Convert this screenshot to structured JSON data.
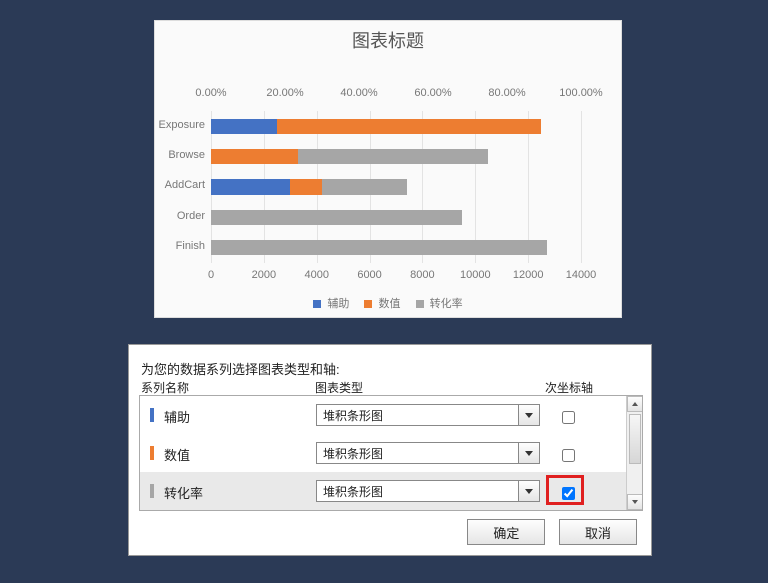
{
  "chart_data": {
    "type": "bar",
    "orientation": "horizontal",
    "stacked": true,
    "title": "图表标题",
    "categories": [
      "Exposure",
      "Browse",
      "AddCart",
      "Order",
      "Finish"
    ],
    "series": [
      {
        "name": "辅助",
        "color": "#4472c4",
        "values": [
          2500,
          0,
          3000,
          0,
          0
        ]
      },
      {
        "name": "数值",
        "color": "#ed7d31",
        "values": [
          10000,
          3300,
          1200,
          0,
          0
        ]
      },
      {
        "name": "转化率",
        "color": "#a6a6a6",
        "values": [
          0,
          7200,
          3200,
          9500,
          12700
        ]
      }
    ],
    "x_bottom": {
      "label": "",
      "min": 0,
      "max": 14000,
      "ticks": [
        0,
        2000,
        4000,
        6000,
        8000,
        10000,
        12000,
        14000
      ]
    },
    "x_top": {
      "label": "",
      "min": 0,
      "max": 1.0,
      "ticks_pct": [
        "0.00%",
        "20.00%",
        "40.00%",
        "60.00%",
        "80.00%",
        "100.00%"
      ]
    }
  },
  "legend": [
    {
      "label": "辅助",
      "color": "#4472c4"
    },
    {
      "label": "数值",
      "color": "#ed7d31"
    },
    {
      "label": "转化率",
      "color": "#a6a6a6"
    }
  ],
  "dialog": {
    "prompt": "为您的数据系列选择图表类型和轴:",
    "columns": {
      "name": "系列名称",
      "type": "图表类型",
      "secondary_axis": "次坐标轴"
    },
    "rows": [
      {
        "name": "辅助",
        "color": "#4472c4",
        "chart_type": "堆积条形图",
        "secondary_axis": false
      },
      {
        "name": "数值",
        "color": "#ed7d31",
        "chart_type": "堆积条形图",
        "secondary_axis": false
      },
      {
        "name": "转化率",
        "color": "#a6a6a6",
        "chart_type": "堆积条形图",
        "secondary_axis": true
      }
    ],
    "ok": "确定",
    "cancel": "取消"
  }
}
